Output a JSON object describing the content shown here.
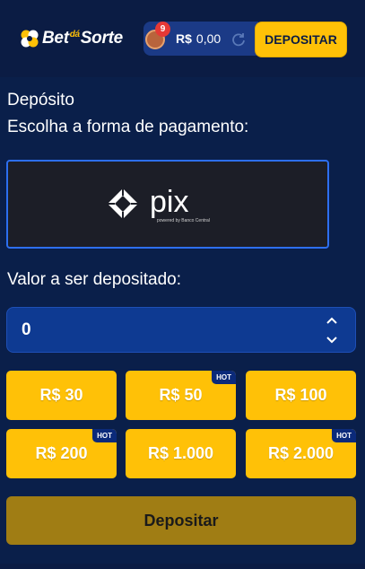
{
  "header": {
    "logo_bet": "Bet",
    "logo_da": "dá",
    "logo_sorte": "Sorte",
    "notification_count": "9",
    "currency": "R$",
    "balance": "0,00",
    "deposit_button": "DEPOSITAR"
  },
  "main": {
    "title": "Depósito",
    "subtitle": "Escolha a forma de pagamento:",
    "payment_method": {
      "name": "pix",
      "tagline": "powered by Banco Central"
    },
    "amount_label": "Valor a ser depositado:",
    "amount_value": "0",
    "quick_amounts": [
      {
        "label": "R$ 30",
        "hot": false
      },
      {
        "label": "R$ 50",
        "hot": true
      },
      {
        "label": "R$ 100",
        "hot": false
      },
      {
        "label": "R$ 200",
        "hot": true
      },
      {
        "label": "R$ 1.000",
        "hot": false
      },
      {
        "label": "R$ 2.000",
        "hot": true
      }
    ],
    "hot_label": "HOT",
    "submit_button": "Depositar"
  },
  "colors": {
    "background": "#0a1f4a",
    "accent": "#ffc107",
    "input_bg": "#0e3a92",
    "submit_disabled": "#a07d14",
    "pix_border": "#2d6ff0"
  }
}
